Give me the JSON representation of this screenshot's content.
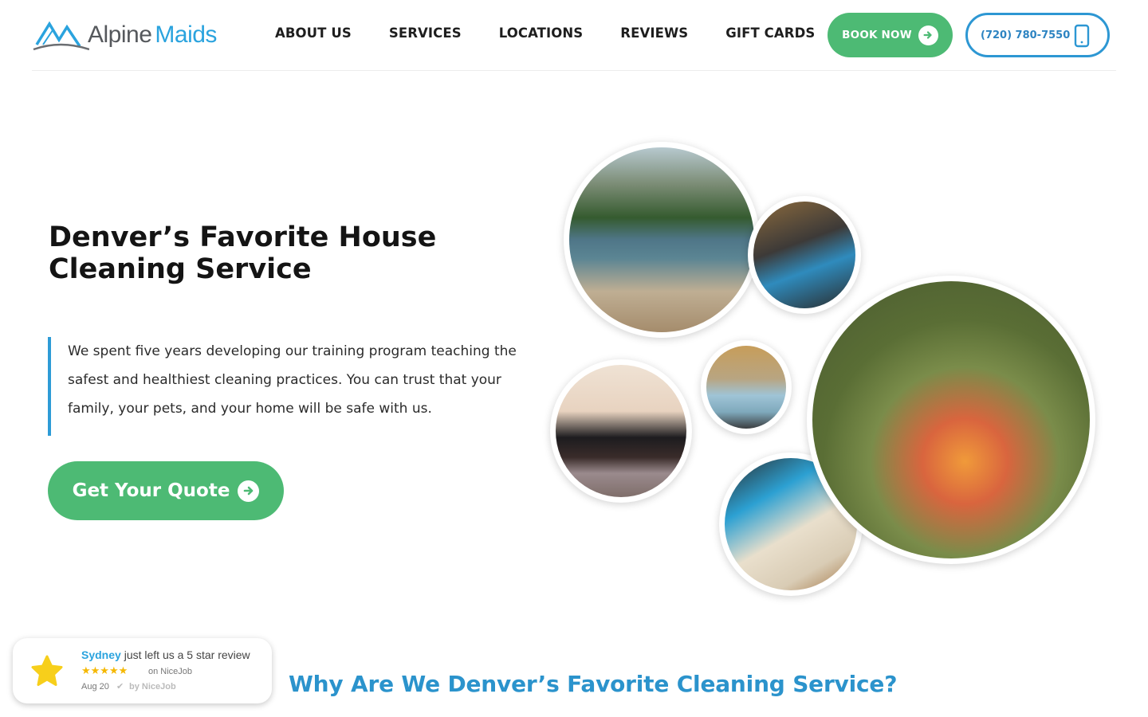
{
  "header": {
    "logo": {
      "word1": "Alpine",
      "word2": "Maids",
      "icon": "mountain-logo-icon"
    },
    "nav": [
      {
        "label": "ABOUT US"
      },
      {
        "label": "SERVICES"
      },
      {
        "label": "LOCATIONS"
      },
      {
        "label": "REVIEWS"
      },
      {
        "label": "GIFT CARDS"
      }
    ],
    "book_now": {
      "label": "BOOK NOW",
      "icon": "arrow-right-circle-icon"
    },
    "phone": {
      "label": "(720) 780-7550",
      "icon": "mobile-phone-icon"
    }
  },
  "hero": {
    "title": "Denver’s Favorite House Cleaning Service",
    "description": "We spent five years developing our training program teaching the safest and healthiest cleaning practices. You can trust that your family, your pets, and your home will be safe with us.",
    "cta": {
      "label": "Get Your Quote",
      "icon": "arrow-right-circle-icon"
    },
    "photos": [
      {
        "name": "hikers-at-mountain-lake"
      },
      {
        "name": "cleaner-wiping-microwave"
      },
      {
        "name": "woman-on-phone-with-laptop"
      },
      {
        "name": "cleaners-with-company-car"
      },
      {
        "name": "cleaner-dusting-vent"
      },
      {
        "name": "family-walking-outdoors"
      }
    ]
  },
  "review_widget": {
    "reviewer": "Sydney",
    "message": " just left us a 5 star review",
    "stars": "★★★★★",
    "rating": 5,
    "source": "on NiceJob",
    "date": "Aug 20",
    "verified_by": "by NiceJob"
  },
  "section": {
    "title": "Why Are We Denver’s Favorite Cleaning Service?"
  },
  "colors": {
    "brand_blue": "#2aa3de",
    "brand_green": "#4dba74",
    "phone_border": "#2d97d3",
    "title_blue": "#2b93cc",
    "star_yellow": "#f5b800"
  }
}
